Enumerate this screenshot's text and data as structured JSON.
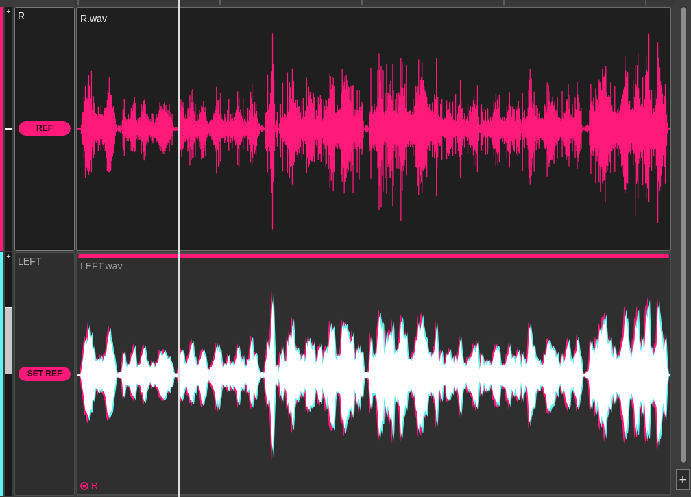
{
  "timeline": {
    "playhead": {
      "level": 0.172
    }
  },
  "tracks": [
    {
      "name": "R",
      "color": "#ff1a7a",
      "selected": true,
      "gain": {
        "plus": "+",
        "minus": "−",
        "level": 0.5
      },
      "button": "REF",
      "file": "R.wav"
    },
    {
      "name": "LEFT",
      "color": "#5ef2f2",
      "selected": false,
      "gain": {
        "plus": "+",
        "minus": "−",
        "level": 0.77
      },
      "button": "SET REF",
      "file": "LEFT.wav",
      "alignment": {
        "reference": "R"
      }
    }
  ],
  "add_track_button": "+"
}
